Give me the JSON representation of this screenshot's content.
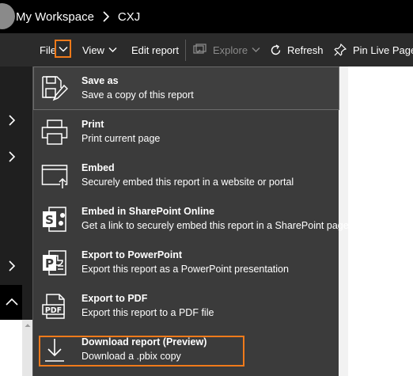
{
  "header": {
    "workspace": "My Workspace",
    "report": "CXJ"
  },
  "toolbar": {
    "file": "File",
    "view": "View",
    "edit_report": "Edit report",
    "explore": "Explore",
    "refresh": "Refresh",
    "pin_live_page": "Pin Live Page"
  },
  "file_menu": {
    "items": [
      {
        "title": "Save as",
        "desc": "Save a copy of this report",
        "icon": "save-as-icon"
      },
      {
        "title": "Print",
        "desc": "Print current page",
        "icon": "print-icon"
      },
      {
        "title": "Embed",
        "desc": "Securely embed this report in a website or portal",
        "icon": "embed-icon"
      },
      {
        "title": "Embed in SharePoint Online",
        "desc": "Get a link to securely embed this report in a SharePoint page",
        "icon": "sharepoint-icon"
      },
      {
        "title": "Export to PowerPoint",
        "desc": "Export this report as a PowerPoint presentation",
        "icon": "powerpoint-icon"
      },
      {
        "title": "Export to PDF",
        "desc": "Export this report to a PDF file",
        "icon": "pdf-icon"
      },
      {
        "title": "Download report (Preview)",
        "desc": "Download a .pbix copy",
        "icon": "download-icon"
      }
    ]
  },
  "colors": {
    "annotation": "#f07a1a",
    "menu_bg": "#3b3b3b",
    "command_bar_bg": "#2b2b2b"
  }
}
